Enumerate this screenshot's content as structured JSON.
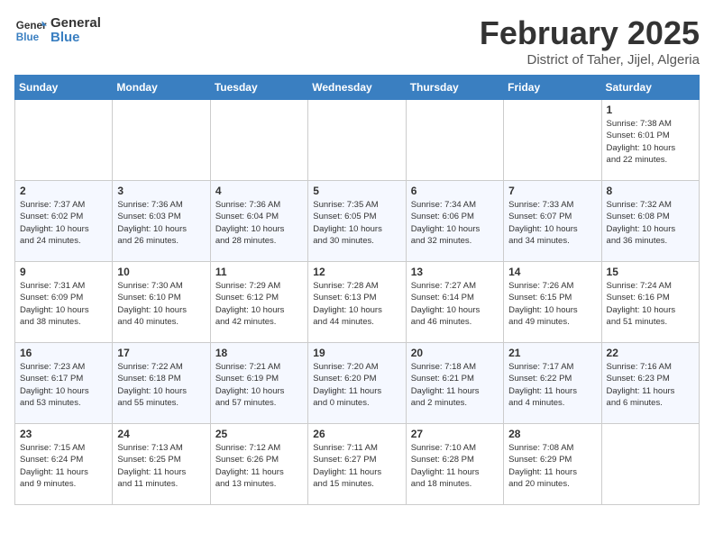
{
  "header": {
    "logo_general": "General",
    "logo_blue": "Blue",
    "month": "February 2025",
    "location": "District of Taher, Jijel, Algeria"
  },
  "days_of_week": [
    "Sunday",
    "Monday",
    "Tuesday",
    "Wednesday",
    "Thursday",
    "Friday",
    "Saturday"
  ],
  "weeks": [
    [
      {
        "day": "",
        "info": ""
      },
      {
        "day": "",
        "info": ""
      },
      {
        "day": "",
        "info": ""
      },
      {
        "day": "",
        "info": ""
      },
      {
        "day": "",
        "info": ""
      },
      {
        "day": "",
        "info": ""
      },
      {
        "day": "1",
        "info": "Sunrise: 7:38 AM\nSunset: 6:01 PM\nDaylight: 10 hours\nand 22 minutes."
      }
    ],
    [
      {
        "day": "2",
        "info": "Sunrise: 7:37 AM\nSunset: 6:02 PM\nDaylight: 10 hours\nand 24 minutes."
      },
      {
        "day": "3",
        "info": "Sunrise: 7:36 AM\nSunset: 6:03 PM\nDaylight: 10 hours\nand 26 minutes."
      },
      {
        "day": "4",
        "info": "Sunrise: 7:36 AM\nSunset: 6:04 PM\nDaylight: 10 hours\nand 28 minutes."
      },
      {
        "day": "5",
        "info": "Sunrise: 7:35 AM\nSunset: 6:05 PM\nDaylight: 10 hours\nand 30 minutes."
      },
      {
        "day": "6",
        "info": "Sunrise: 7:34 AM\nSunset: 6:06 PM\nDaylight: 10 hours\nand 32 minutes."
      },
      {
        "day": "7",
        "info": "Sunrise: 7:33 AM\nSunset: 6:07 PM\nDaylight: 10 hours\nand 34 minutes."
      },
      {
        "day": "8",
        "info": "Sunrise: 7:32 AM\nSunset: 6:08 PM\nDaylight: 10 hours\nand 36 minutes."
      }
    ],
    [
      {
        "day": "9",
        "info": "Sunrise: 7:31 AM\nSunset: 6:09 PM\nDaylight: 10 hours\nand 38 minutes."
      },
      {
        "day": "10",
        "info": "Sunrise: 7:30 AM\nSunset: 6:10 PM\nDaylight: 10 hours\nand 40 minutes."
      },
      {
        "day": "11",
        "info": "Sunrise: 7:29 AM\nSunset: 6:12 PM\nDaylight: 10 hours\nand 42 minutes."
      },
      {
        "day": "12",
        "info": "Sunrise: 7:28 AM\nSunset: 6:13 PM\nDaylight: 10 hours\nand 44 minutes."
      },
      {
        "day": "13",
        "info": "Sunrise: 7:27 AM\nSunset: 6:14 PM\nDaylight: 10 hours\nand 46 minutes."
      },
      {
        "day": "14",
        "info": "Sunrise: 7:26 AM\nSunset: 6:15 PM\nDaylight: 10 hours\nand 49 minutes."
      },
      {
        "day": "15",
        "info": "Sunrise: 7:24 AM\nSunset: 6:16 PM\nDaylight: 10 hours\nand 51 minutes."
      }
    ],
    [
      {
        "day": "16",
        "info": "Sunrise: 7:23 AM\nSunset: 6:17 PM\nDaylight: 10 hours\nand 53 minutes."
      },
      {
        "day": "17",
        "info": "Sunrise: 7:22 AM\nSunset: 6:18 PM\nDaylight: 10 hours\nand 55 minutes."
      },
      {
        "day": "18",
        "info": "Sunrise: 7:21 AM\nSunset: 6:19 PM\nDaylight: 10 hours\nand 57 minutes."
      },
      {
        "day": "19",
        "info": "Sunrise: 7:20 AM\nSunset: 6:20 PM\nDaylight: 11 hours\nand 0 minutes."
      },
      {
        "day": "20",
        "info": "Sunrise: 7:18 AM\nSunset: 6:21 PM\nDaylight: 11 hours\nand 2 minutes."
      },
      {
        "day": "21",
        "info": "Sunrise: 7:17 AM\nSunset: 6:22 PM\nDaylight: 11 hours\nand 4 minutes."
      },
      {
        "day": "22",
        "info": "Sunrise: 7:16 AM\nSunset: 6:23 PM\nDaylight: 11 hours\nand 6 minutes."
      }
    ],
    [
      {
        "day": "23",
        "info": "Sunrise: 7:15 AM\nSunset: 6:24 PM\nDaylight: 11 hours\nand 9 minutes."
      },
      {
        "day": "24",
        "info": "Sunrise: 7:13 AM\nSunset: 6:25 PM\nDaylight: 11 hours\nand 11 minutes."
      },
      {
        "day": "25",
        "info": "Sunrise: 7:12 AM\nSunset: 6:26 PM\nDaylight: 11 hours\nand 13 minutes."
      },
      {
        "day": "26",
        "info": "Sunrise: 7:11 AM\nSunset: 6:27 PM\nDaylight: 11 hours\nand 15 minutes."
      },
      {
        "day": "27",
        "info": "Sunrise: 7:10 AM\nSunset: 6:28 PM\nDaylight: 11 hours\nand 18 minutes."
      },
      {
        "day": "28",
        "info": "Sunrise: 7:08 AM\nSunset: 6:29 PM\nDaylight: 11 hours\nand 20 minutes."
      },
      {
        "day": "",
        "info": ""
      }
    ]
  ]
}
